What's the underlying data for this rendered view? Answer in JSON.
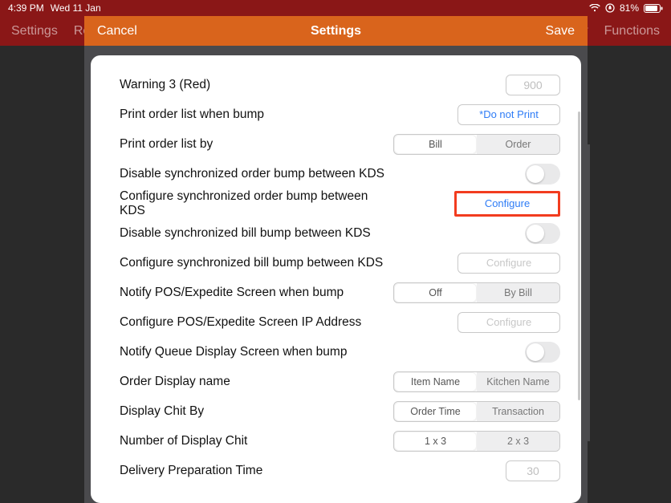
{
  "status": {
    "time": "4:39 PM",
    "date": "Wed 11 Jan",
    "battery": "81%"
  },
  "appNav": {
    "left": [
      "Settings",
      "Re"
    ],
    "right": [
      "y",
      "Functions"
    ]
  },
  "modal": {
    "cancel": "Cancel",
    "title": "Settings",
    "save": "Save"
  },
  "rows": {
    "warning3": {
      "label": "Warning 3 (Red)",
      "value": "900"
    },
    "printOrderListBump": {
      "label": "Print order list when bump",
      "button": "*Do not Print"
    },
    "printOrderListBy": {
      "label": "Print order list by",
      "left": "Bill",
      "right": "Order",
      "selected": "left"
    },
    "disableSyncOrder": {
      "label": "Disable synchronized order bump between KDS"
    },
    "configSyncOrder": {
      "label": "Configure synchronized order bump between KDS",
      "button": "Configure"
    },
    "disableSyncBill": {
      "label": "Disable synchronized bill bump between KDS"
    },
    "configSyncBill": {
      "label": "Configure synchronized bill bump between KDS",
      "button": "Configure"
    },
    "notifyPos": {
      "label": "Notify POS/Expedite Screen when bump",
      "left": "Off",
      "right": "By Bill",
      "selected": "left"
    },
    "configPosIp": {
      "label": "Configure POS/Expedite Screen IP Address",
      "button": "Configure"
    },
    "notifyQueue": {
      "label": "Notify Queue Display Screen when bump"
    },
    "orderDisplayName": {
      "label": "Order Display name",
      "left": "Item Name",
      "right": "Kitchen Name",
      "selected": "left"
    },
    "displayChitBy": {
      "label": "Display Chit By",
      "left": "Order Time",
      "right": "Transaction",
      "selected": "left"
    },
    "numDisplayChit": {
      "label": "Number of Display Chit",
      "left": "1 x 3",
      "right": "2 x 3",
      "selected": "left"
    },
    "deliveryPrep": {
      "label": "Delivery Preparation Time",
      "value": "30"
    }
  }
}
